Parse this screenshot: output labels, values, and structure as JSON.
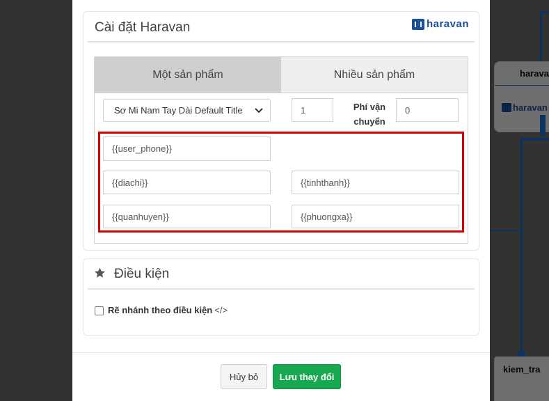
{
  "background": {
    "node_top_title": "haravan",
    "node_top_logo": "haravan",
    "node_bottom_title": "kiem_tra"
  },
  "modal": {
    "settings_panel": {
      "title": "Cài đặt Haravan",
      "logo_text": "haravan",
      "tabs": [
        {
          "label": "Một sản phẩm",
          "active": true
        },
        {
          "label": "Nhiều sản phẩm",
          "active": false
        }
      ],
      "product_select": {
        "value": "Sơ Mi Nam Tay Dài Default Title"
      },
      "quantity": {
        "value": "1"
      },
      "shipping_fee_label": "Phí vận chuyển",
      "shipping_fee": {
        "value": "0"
      },
      "fields": {
        "user_phone": "{{user_phone}}",
        "address": "{{diachi}}",
        "province": "{{tinhthanh}}",
        "district": "{{quanhuyen}}",
        "ward": "{{phuongxa}}"
      }
    },
    "condition_panel": {
      "title": "Điều kiện",
      "checkbox_label": "Rẽ nhánh theo điều kiện",
      "checkbox_checked": false,
      "code_icon": "code-icon"
    },
    "footer": {
      "cancel_label": "Hủy bỏ",
      "save_label": "Lưu thay đổi"
    }
  },
  "colors": {
    "accent_green": "#18a84f",
    "highlight_red": "#d60000",
    "brand_blue": "#1a4f9c",
    "flow_line_blue": "#1b6fd1"
  }
}
